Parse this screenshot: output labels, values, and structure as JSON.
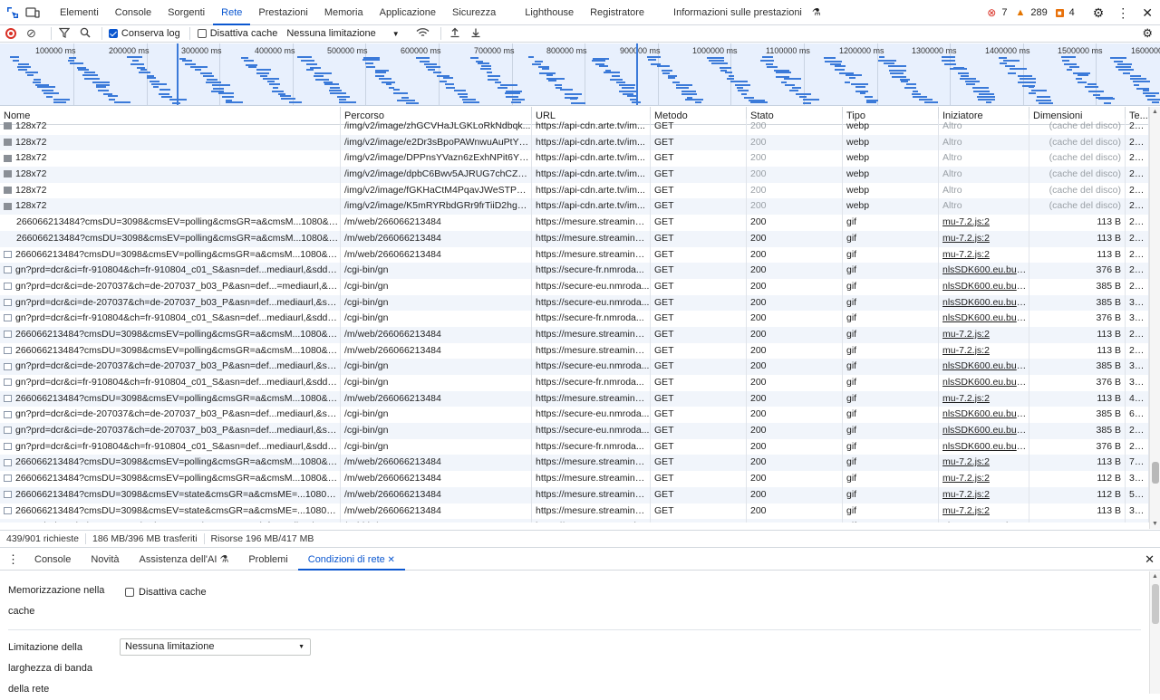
{
  "toptabs": [
    "Elementi",
    "Console",
    "Sorgenti",
    "Rete",
    "Prestazioni",
    "Memoria",
    "Applicazione",
    "Sicurezza",
    "Lighthouse",
    "Registratore",
    "Informazioni sulle prestazioni"
  ],
  "status": {
    "errors": "7",
    "warnings": "289",
    "issues": "4"
  },
  "toolbar": {
    "preserve_log": "Conserva log",
    "disable_cache": "Disattiva cache",
    "throttle": "Nessuna limitazione"
  },
  "overview_ticks": [
    "100000 ms",
    "200000 ms",
    "300000 ms",
    "400000 ms",
    "500000 ms",
    "600000 ms",
    "700000 ms",
    "800000 ms",
    "900000 ms",
    "1000000 ms",
    "1100000 ms",
    "1200000 ms",
    "1300000 ms",
    "1400000 ms",
    "1500000 ms",
    "1600000 ms"
  ],
  "columns": [
    "Nome",
    "Percorso",
    "URL",
    "Metodo",
    "Stato",
    "Tipo",
    "Iniziatore",
    "Dimensioni",
    "Te..."
  ],
  "rows": [
    {
      "name": "128x72",
      "path": "/img/v2/image/zhGCVHaJLGKLoRkNdbqk...",
      "url": "https://api-cdn.arte.tv/im...",
      "method": "GET",
      "status": "200",
      "type": "webp",
      "init": "Altro",
      "size": "(cache del disco)",
      "time": "20 ...",
      "icon": "img",
      "cached": true
    },
    {
      "name": "128x72",
      "path": "/img/v2/image/e2Dr3sBpoPAWnwuAuPtY8...",
      "url": "https://api-cdn.arte.tv/im...",
      "method": "GET",
      "status": "200",
      "type": "webp",
      "init": "Altro",
      "size": "(cache del disco)",
      "time": "20 ...",
      "icon": "img",
      "cached": true
    },
    {
      "name": "128x72",
      "path": "/img/v2/image/DPPnsYVazn6zExhNPit6Yh/...",
      "url": "https://api-cdn.arte.tv/im...",
      "method": "GET",
      "status": "200",
      "type": "webp",
      "init": "Altro",
      "size": "(cache del disco)",
      "time": "20 ...",
      "icon": "img",
      "cached": true
    },
    {
      "name": "128x72",
      "path": "/img/v2/image/dpbC6Bwv5AJRUG7chCZG...",
      "url": "https://api-cdn.arte.tv/im...",
      "method": "GET",
      "status": "200",
      "type": "webp",
      "init": "Altro",
      "size": "(cache del disco)",
      "time": "20 ...",
      "icon": "img",
      "cached": true
    },
    {
      "name": "128x72",
      "path": "/img/v2/image/fGKHaCtM4PqavJWeSTPVFP...",
      "url": "https://api-cdn.arte.tv/im...",
      "method": "GET",
      "status": "200",
      "type": "webp",
      "init": "Altro",
      "size": "(cache del disco)",
      "time": "20 ...",
      "icon": "img",
      "cached": true
    },
    {
      "name": "128x72",
      "path": "/img/v2/image/K5mRYRbdGRr9frTiiD2hgb/...",
      "url": "https://api-cdn.arte.tv/im...",
      "method": "GET",
      "status": "200",
      "type": "webp",
      "init": "Altro",
      "size": "(cache del disco)",
      "time": "20 ...",
      "icon": "img",
      "cached": true
    },
    {
      "name": "266066213484?cmsDU=3098&cmsEV=polling&cmsGR=a&cmsM...1080&scp...",
      "path": "/m/web/266066213484",
      "url": "https://mesure.streaming....",
      "method": "GET",
      "status": "200",
      "type": "gif",
      "init": "mu-7.2.js:2",
      "size": "113 B",
      "time": "27...",
      "icon": "none"
    },
    {
      "name": "266066213484?cmsDU=3098&cmsEV=polling&cmsGR=a&cmsM...1080&scp...",
      "path": "/m/web/266066213484",
      "url": "https://mesure.streaming....",
      "method": "GET",
      "status": "200",
      "type": "gif",
      "init": "mu-7.2.js:2",
      "size": "113 B",
      "time": "22...",
      "icon": "none"
    },
    {
      "name": "266066213484?cmsDU=3098&cmsEV=polling&cmsGR=a&cmsM...1080&scp...",
      "path": "/m/web/266066213484",
      "url": "https://mesure.streaming....",
      "method": "GET",
      "status": "200",
      "type": "gif",
      "init": "mu-7.2.js:2",
      "size": "113 B",
      "time": "25...",
      "icon": "file"
    },
    {
      "name": "gn?prd=dcr&ci=fr-910804&ch=fr-910804_c01_S&asn=def...mediaurl,&sdd=...",
      "path": "/cgi-bin/gn",
      "url": "https://secure-fr.nmroda...",
      "method": "GET",
      "status": "200",
      "type": "gif",
      "init": "nlsSDK600.eu.bundle.",
      "size": "376 B",
      "time": "23...",
      "icon": "file"
    },
    {
      "name": "gn?prd=dcr&ci=de-207037&ch=de-207037_b03_P&asn=def...=mediaurl,&s...",
      "path": "/cgi-bin/gn",
      "url": "https://secure-eu.nmroda...",
      "method": "GET",
      "status": "200",
      "type": "gif",
      "init": "nlsSDK600.eu.bundle.",
      "size": "385 B",
      "time": "23...",
      "icon": "file"
    },
    {
      "name": "gn?prd=dcr&ci=de-207037&ch=de-207037_b03_P&asn=def...mediaurl,&sdd...",
      "path": "/cgi-bin/gn",
      "url": "https://secure-eu.nmroda...",
      "method": "GET",
      "status": "200",
      "type": "gif",
      "init": "nlsSDK600.eu.bundle.",
      "size": "385 B",
      "time": "30...",
      "icon": "file"
    },
    {
      "name": "gn?prd=dcr&ci=fr-910804&ch=fr-910804_c01_S&asn=def...mediaurl,&sdd=...",
      "path": "/cgi-bin/gn",
      "url": "https://secure-fr.nmroda...",
      "method": "GET",
      "status": "200",
      "type": "gif",
      "init": "nlsSDK600.eu.bundle.",
      "size": "376 B",
      "time": "32...",
      "icon": "file"
    },
    {
      "name": "266066213484?cmsDU=3098&cmsEV=polling&cmsGR=a&cmsM...1080&scp...",
      "path": "/m/web/266066213484",
      "url": "https://mesure.streaming....",
      "method": "GET",
      "status": "200",
      "type": "gif",
      "init": "mu-7.2.js:2",
      "size": "113 B",
      "time": "24...",
      "icon": "file"
    },
    {
      "name": "266066213484?cmsDU=3098&cmsEV=polling&cmsGR=a&cmsM...1080&scp...",
      "path": "/m/web/266066213484",
      "url": "https://mesure.streaming....",
      "method": "GET",
      "status": "200",
      "type": "gif",
      "init": "mu-7.2.js:2",
      "size": "113 B",
      "time": "24...",
      "icon": "file"
    },
    {
      "name": "gn?prd=dcr&ci=de-207037&ch=de-207037_b03_P&asn=def...mediaurl,&sdd...",
      "path": "/cgi-bin/gn",
      "url": "https://secure-eu.nmroda...",
      "method": "GET",
      "status": "200",
      "type": "gif",
      "init": "nlsSDK600.eu.bundle.",
      "size": "385 B",
      "time": "38...",
      "icon": "file"
    },
    {
      "name": "gn?prd=dcr&ci=fr-910804&ch=fr-910804_c01_S&asn=def...mediaurl,&sdd=...",
      "path": "/cgi-bin/gn",
      "url": "https://secure-fr.nmroda...",
      "method": "GET",
      "status": "200",
      "type": "gif",
      "init": "nlsSDK600.eu.bundle.",
      "size": "376 B",
      "time": "39...",
      "icon": "file"
    },
    {
      "name": "266066213484?cmsDU=3098&cmsEV=polling&cmsGR=a&cmsM...1080&scp...",
      "path": "/m/web/266066213484",
      "url": "https://mesure.streaming....",
      "method": "GET",
      "status": "200",
      "type": "gif",
      "init": "mu-7.2.js:2",
      "size": "113 B",
      "time": "40...",
      "icon": "file"
    },
    {
      "name": "gn?prd=dcr&ci=de-207037&ch=de-207037_b03_P&asn=def...mediaurl,&sdd...",
      "path": "/cgi-bin/gn",
      "url": "https://secure-eu.nmroda...",
      "method": "GET",
      "status": "200",
      "type": "gif",
      "init": "nlsSDK600.eu.bundle.",
      "size": "385 B",
      "time": "63...",
      "icon": "file"
    },
    {
      "name": "gn?prd=dcr&ci=de-207037&ch=de-207037_b03_P&asn=def...mediaurl,&sdd...",
      "path": "/cgi-bin/gn",
      "url": "https://secure-eu.nmroda...",
      "method": "GET",
      "status": "200",
      "type": "gif",
      "init": "nlsSDK600.eu.bundle.",
      "size": "385 B",
      "time": "27...",
      "icon": "file"
    },
    {
      "name": "gn?prd=dcr&ci=fr-910804&ch=fr-910804_c01_S&asn=def...mediaurl,&sdd=...",
      "path": "/cgi-bin/gn",
      "url": "https://secure-fr.nmroda...",
      "method": "GET",
      "status": "200",
      "type": "gif",
      "init": "nlsSDK600.eu.bundle.",
      "size": "376 B",
      "time": "28...",
      "icon": "file"
    },
    {
      "name": "266066213484?cmsDU=3098&cmsEV=polling&cmsGR=a&cmsM...1080&scp...",
      "path": "/m/web/266066213484",
      "url": "https://mesure.streaming....",
      "method": "GET",
      "status": "200",
      "type": "gif",
      "init": "mu-7.2.js:2",
      "size": "113 B",
      "time": "71...",
      "icon": "file"
    },
    {
      "name": "266066213484?cmsDU=3098&cmsEV=polling&cmsGR=a&cmsM...1080&scp...",
      "path": "/m/web/266066213484",
      "url": "https://mesure.streaming....",
      "method": "GET",
      "status": "200",
      "type": "gif",
      "init": "mu-7.2.js:2",
      "size": "112 B",
      "time": "30...",
      "icon": "file"
    },
    {
      "name": "266066213484?cmsDU=3098&cmsEV=state&cmsGR=a&cmsME=...1080&sc...",
      "path": "/m/web/266066213484",
      "url": "https://mesure.streaming....",
      "method": "GET",
      "status": "200",
      "type": "gif",
      "init": "mu-7.2.js:2",
      "size": "112 B",
      "time": "55 ...",
      "icon": "file"
    },
    {
      "name": "266066213484?cmsDU=3098&cmsEV=state&cmsGR=a&cmsME=...1080&sc...",
      "path": "/m/web/266066213484",
      "url": "https://mesure.streaming....",
      "method": "GET",
      "status": "200",
      "type": "gif",
      "init": "mu-7.2.js:2",
      "size": "113 B",
      "time": "38...",
      "icon": "file"
    },
    {
      "name": "gn?prd=dcr&ci=de-207037&ch=de-207037_b03_P&asn=def...mediaurl,&sdd...",
      "path": "/cgi-bin/gn",
      "url": "https://secure-eu.nmroda...",
      "method": "GET",
      "status": "200",
      "type": "gif",
      "init": "nlsSDK600.eu.bundle.",
      "size": "385 B",
      "time": "43...",
      "icon": "none"
    }
  ],
  "statusbar": {
    "requests": "439/901 richieste",
    "transferred": "186 MB/396 MB trasferiti",
    "resources": "Risorse 196 MB/417 MB"
  },
  "drawer_tabs": [
    "Console",
    "Novità",
    "Assistenza dell'AI",
    "Problemi",
    "Condizioni di rete"
  ],
  "drawer": {
    "cache_label": "Memorizzazione nella cache",
    "cache_checkbox": "Disattiva cache",
    "bw_label": "Limitazione della larghezza di banda della rete",
    "bw_select": "Nessuna limitazione"
  }
}
